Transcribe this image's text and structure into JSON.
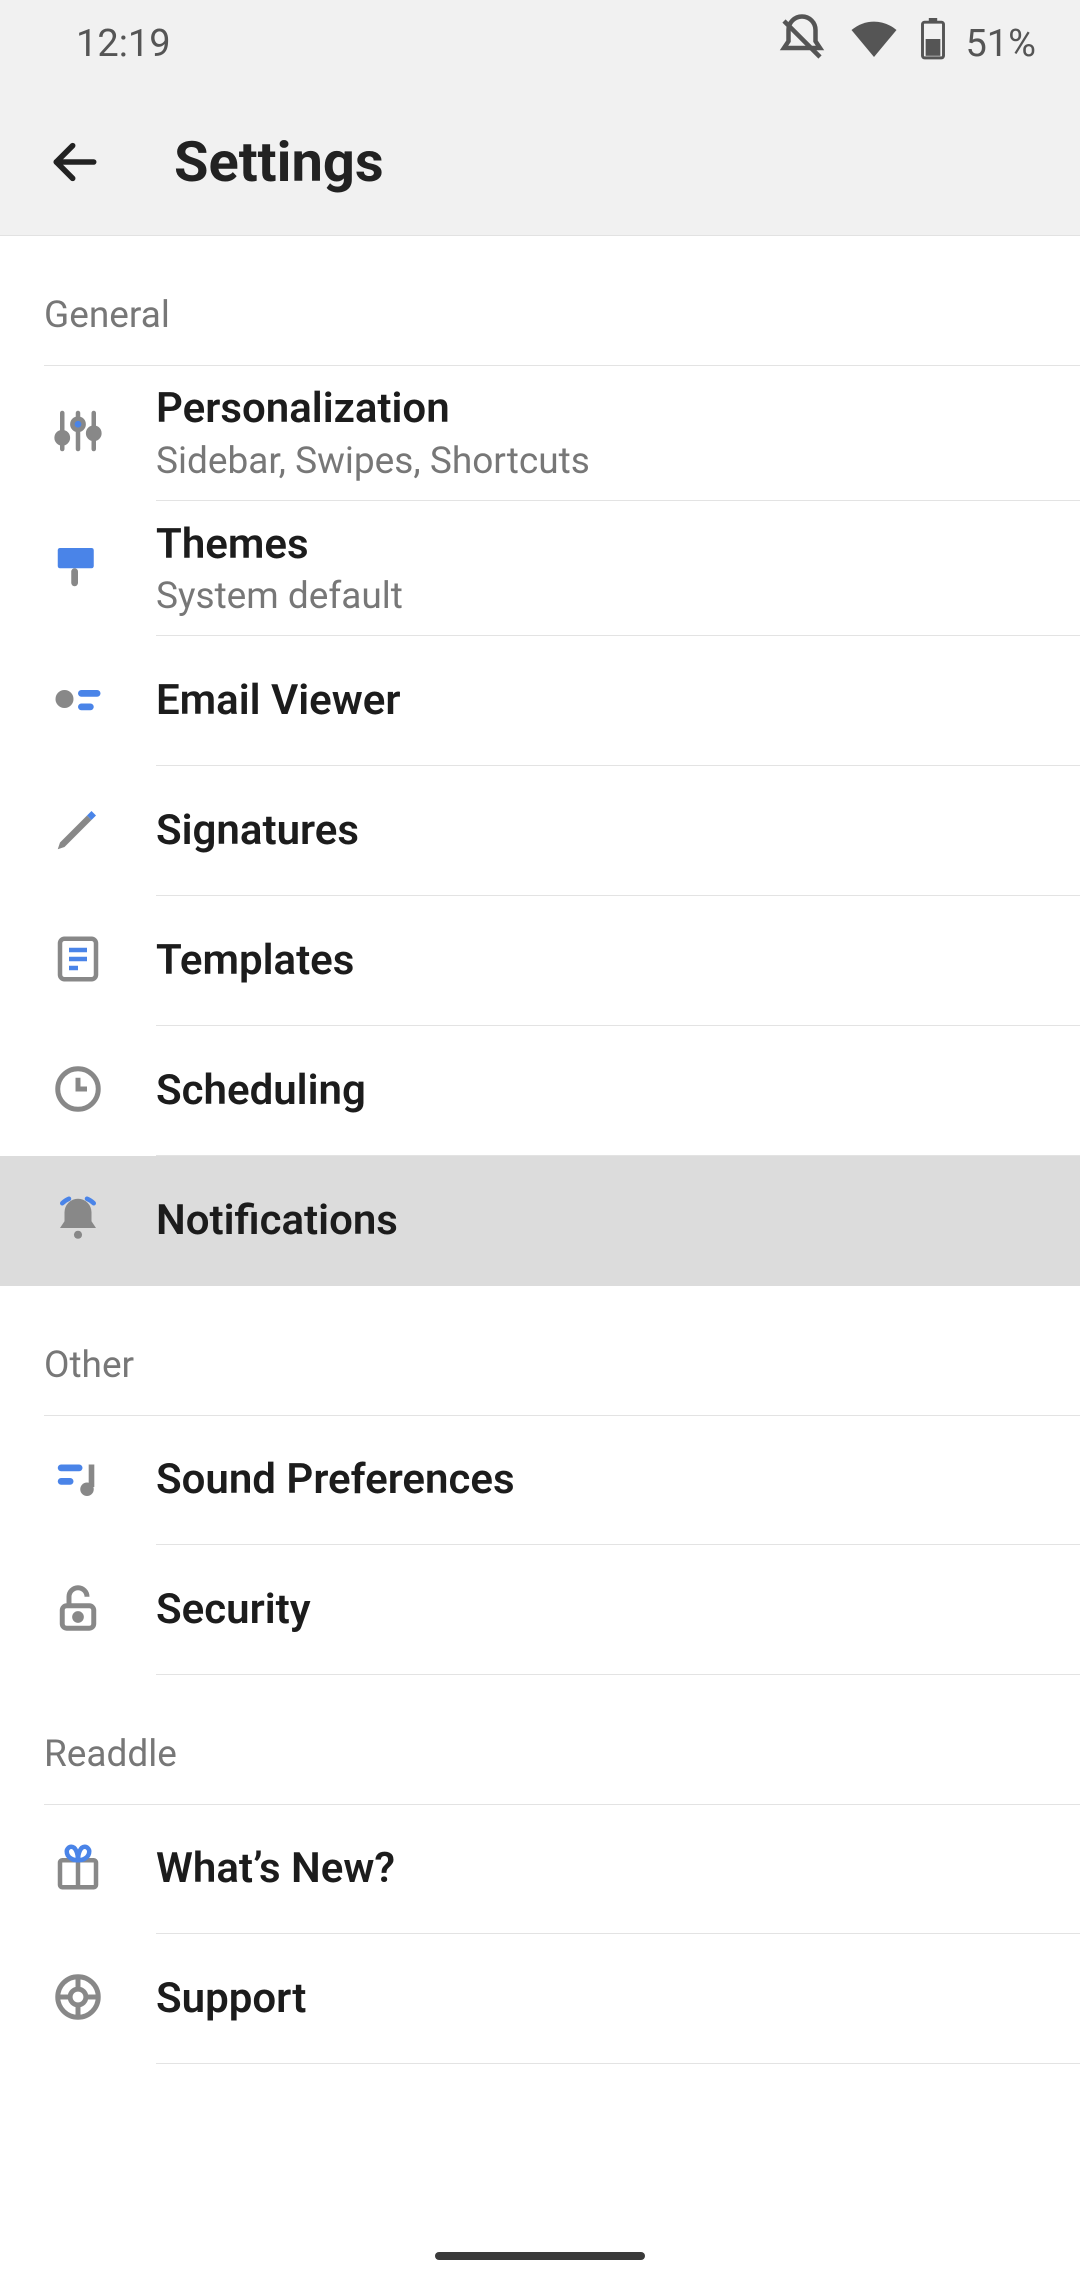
{
  "status": {
    "time": "12:19",
    "battery": "51%"
  },
  "header": {
    "title": "Settings"
  },
  "sections": {
    "general": {
      "label": "General",
      "items": {
        "personalization": {
          "title": "Personalization",
          "sub": "Sidebar, Swipes, Shortcuts"
        },
        "themes": {
          "title": "Themes",
          "sub": "System default"
        },
        "emailviewer": {
          "title": "Email Viewer"
        },
        "signatures": {
          "title": "Signatures"
        },
        "templates": {
          "title": "Templates"
        },
        "scheduling": {
          "title": "Scheduling"
        },
        "notifications": {
          "title": "Notifications"
        }
      }
    },
    "other": {
      "label": "Other",
      "items": {
        "sound": {
          "title": "Sound Preferences"
        },
        "security": {
          "title": "Security"
        }
      }
    },
    "readdle": {
      "label": "Readdle",
      "items": {
        "whatsnew": {
          "title": "What’s New?"
        },
        "support": {
          "title": "Support"
        }
      }
    }
  }
}
